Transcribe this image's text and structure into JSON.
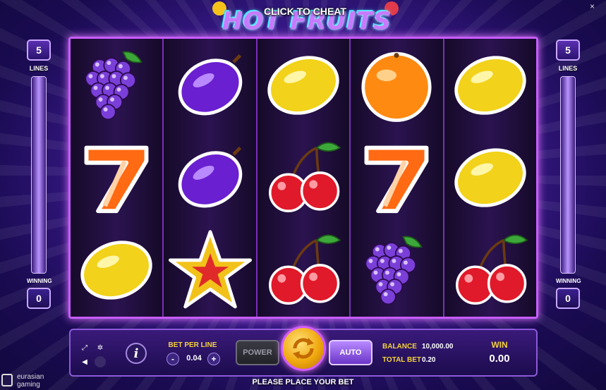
{
  "header": {
    "game_title": "HOT FRUITS",
    "cheat_label": "CLICK TO CHEAT",
    "close_glyph": "×"
  },
  "left_panel": {
    "lines_value": "5",
    "lines_label": "LINES",
    "winning_label": "WINNING",
    "winning_value": "0"
  },
  "right_panel": {
    "lines_value": "5",
    "lines_label": "LINES",
    "winning_label": "WINNING",
    "winning_value": "0"
  },
  "reels": [
    [
      "grapes",
      "seven",
      "lemon"
    ],
    [
      "plum",
      "plum",
      "star"
    ],
    [
      "lemon",
      "cherries",
      "cherries"
    ],
    [
      "orange",
      "seven",
      "grapes"
    ],
    [
      "lemon",
      "lemon",
      "cherries"
    ]
  ],
  "controls": {
    "bet_per_line_label": "BET PER LINE",
    "bet_per_line_value": "0.04",
    "minus": "-",
    "plus": "+",
    "power_label": "POWER",
    "auto_label": "AUTO",
    "balance_label": "BALANCE",
    "balance_value": "10,000.00",
    "total_bet_label": "TOTAL BET",
    "total_bet_value": "0.20",
    "win_label": "WIN",
    "win_value": "0.00",
    "info_glyph": "i"
  },
  "status": {
    "message": "PLEASE PLACE YOUR BET"
  },
  "brand": {
    "line1": "eurasian",
    "line2": "gaming"
  },
  "colors": {
    "frame": "#c75cff",
    "gold": "#f4d23a",
    "panel": "#2a1466"
  }
}
